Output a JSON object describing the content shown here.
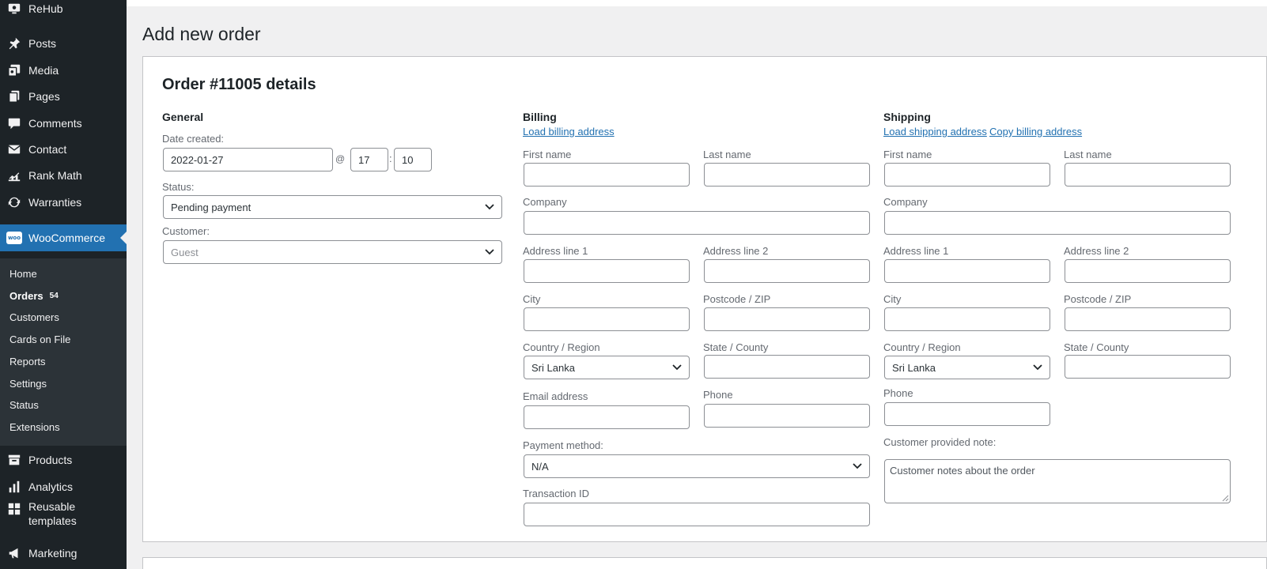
{
  "sidebar": {
    "menu": [
      {
        "label": "ReHub",
        "icon": "monitor-icon"
      },
      {
        "label": "Posts",
        "icon": "pin-icon"
      },
      {
        "label": "Media",
        "icon": "media-icon"
      },
      {
        "label": "Pages",
        "icon": "pages-icon"
      },
      {
        "label": "Comments",
        "icon": "comment-icon"
      },
      {
        "label": "Contact",
        "icon": "envelope-icon"
      },
      {
        "label": "Rank Math",
        "icon": "rankmath-icon"
      },
      {
        "label": "Warranties",
        "icon": "refresh-icon"
      },
      {
        "label": "WooCommerce",
        "icon": "woocommerce-icon",
        "logo_text": "woo"
      },
      {
        "label": "Products",
        "icon": "archive-icon"
      },
      {
        "label": "Analytics",
        "icon": "bar-chart-icon"
      },
      {
        "label": "Reusable templates",
        "icon": "grid-icon"
      },
      {
        "label": "Marketing",
        "icon": "megaphone-icon"
      }
    ],
    "submenu": [
      {
        "label": "Home"
      },
      {
        "label": "Orders",
        "badge": "54"
      },
      {
        "label": "Customers"
      },
      {
        "label": "Cards on File"
      },
      {
        "label": "Reports"
      },
      {
        "label": "Settings"
      },
      {
        "label": "Status"
      },
      {
        "label": "Extensions"
      }
    ],
    "reusable_line1": "Reusable",
    "reusable_line2": "templates"
  },
  "page_title": "Add new order",
  "order": {
    "heading": "Order #11005 details",
    "general": {
      "heading": "General",
      "date_label": "Date created:",
      "date_value": "2022-01-27",
      "at": "@",
      "hour": "17",
      "colon": ":",
      "minute": "10",
      "status_label": "Status:",
      "status_value": "Pending payment",
      "customer_label": "Customer:",
      "customer_value": "Guest"
    },
    "billing": {
      "heading": "Billing",
      "load_link": "Load billing address",
      "first_name": "First name",
      "last_name": "Last name",
      "company": "Company",
      "address1": "Address line 1",
      "address2": "Address line 2",
      "city": "City",
      "postcode": "Postcode / ZIP",
      "country": "Country / Region",
      "country_value": "Sri Lanka",
      "state": "State / County",
      "email": "Email address",
      "phone": "Phone",
      "payment_label": "Payment method:",
      "payment_value": "N/A",
      "transaction": "Transaction ID"
    },
    "shipping": {
      "heading": "Shipping",
      "load_link": "Load shipping address",
      "copy_link": "Copy billing address",
      "first_name": "First name",
      "last_name": "Last name",
      "company": "Company",
      "address1": "Address line 1",
      "address2": "Address line 2",
      "city": "City",
      "postcode": "Postcode / ZIP",
      "country": "Country / Region",
      "country_value": "Sri Lanka",
      "state": "State / County",
      "phone": "Phone",
      "note_label": "Customer provided note:",
      "note_placeholder": "Customer notes about the order"
    }
  },
  "colors": {
    "sidebar_bg": "#1d2327",
    "submenu_bg": "#2c3338",
    "accent": "#2271b1"
  }
}
